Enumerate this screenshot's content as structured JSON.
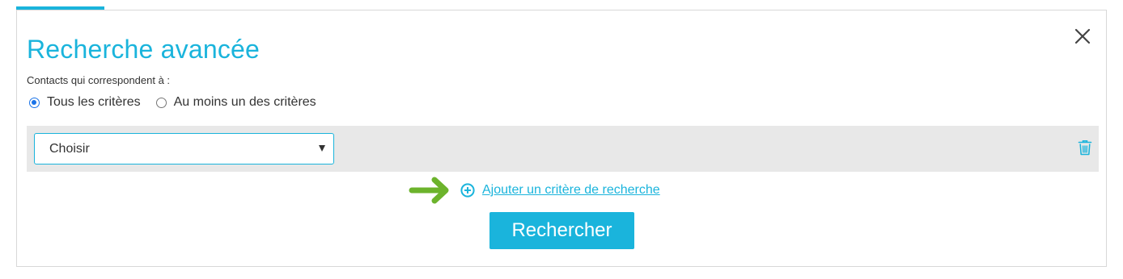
{
  "dialog": {
    "title": "Recherche avancée",
    "close_icon": "close-icon"
  },
  "match": {
    "label": "Contacts qui correspondent à :",
    "options": [
      {
        "label": "Tous les critères",
        "selected": true
      },
      {
        "label": "Au moins un des critères",
        "selected": false
      }
    ]
  },
  "criteria": {
    "rows": [
      {
        "select_value": "Choisir",
        "delete_icon": "trash-icon"
      }
    ],
    "add_label": "Ajouter un critère de recherche",
    "add_icon": "plus-circle-icon"
  },
  "annotation": {
    "icon": "arrow-right-icon",
    "color": "#6cb32c"
  },
  "actions": {
    "search_label": "Rechercher"
  },
  "colors": {
    "accent": "#1ab4dc",
    "row_background": "#e8e8e8",
    "radio": "#1a73e8"
  }
}
